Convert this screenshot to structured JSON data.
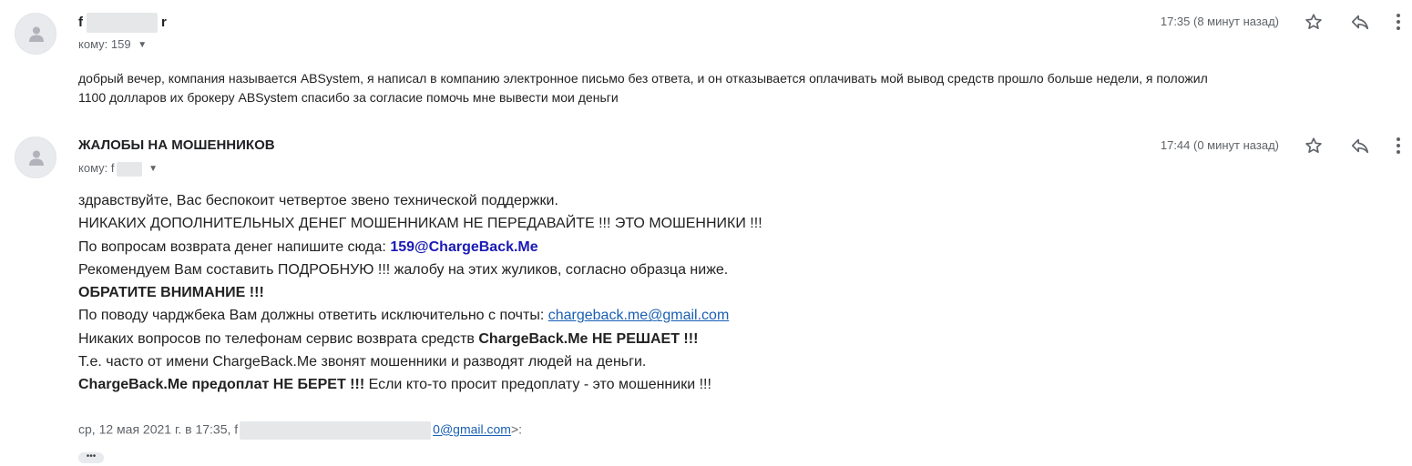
{
  "messages": [
    {
      "sender_initial": "f",
      "sender_final": "r",
      "recipient_label": "кому:",
      "recipient": "159",
      "time": "17:35 (8 минут назад)",
      "body": [
        "добрый вечер, компания называется ABSystem, я написал в компанию электронное письмо без ответа, и он отказывается оплачивать мой вывод средств прошло больше недели, я положил",
        "1100 долларов их брокеру ABSystem спасибо за согласие помочь мне вывести мои деньги"
      ]
    },
    {
      "sender": "ЖАЛОБЫ НА МОШЕННИКОВ",
      "recipient_label": "кому:",
      "recipient": "f",
      "time": "17:44 (0 минут назад)",
      "body": {
        "l1": "здравствуйте, Вас беспокоит четвертое звено технической поддержки.",
        "l2": "НИКАКИХ ДОПОЛНИТЕЛЬНЫХ ДЕНЕГ МОШЕННИКАМ НЕ ПЕРЕДАВАЙТЕ !!! ЭТО МОШЕННИКИ !!!",
        "l3_text": "По вопросам возврата денег напишите сюда: ",
        "l3_email": "159@ChargeBack.Me",
        "l4": "Рекомендуем Вам составить ПОДРОБНУЮ !!! жалобу на этих жуликов, согласно образца ниже.",
        "l5": "ОБРАТИТЕ ВНИМАНИЕ !!!",
        "l6_text": "По поводу чарджбека Вам должны ответить исключительно с почты: ",
        "l6_email": "chargeback.me@gmail.com",
        "l7_text": "Никаких вопросов по телефонам сервис возврата средств ",
        "l7_bold": "ChargeBack.Me НЕ РЕШАЕТ !!!",
        "l8": "Т.е. часто от имени ChargeBack.Me звонят мошенники и разводят людей на деньги.",
        "l9_bold": "ChargeBack.Me предоплат НЕ БЕРЕТ !!!",
        "l9_text": " Если кто-то просит предоплату - это мошенники !!!"
      },
      "quote_header": "ср, 12 мая 2021 г. в 17:35, f",
      "quote_email_tail": "0@gmail.com",
      "quote_suffix": ">:",
      "quote_more": "•••"
    }
  ],
  "icons": {
    "star": "star-icon",
    "reply": "reply-icon",
    "more": "more-vert-icon",
    "avatar": "person-icon",
    "caret": "caret-down-icon"
  },
  "colors": {
    "link": "#1a5fb4",
    "email_highlight": "#1a1ab5",
    "meta": "#5f6368"
  }
}
